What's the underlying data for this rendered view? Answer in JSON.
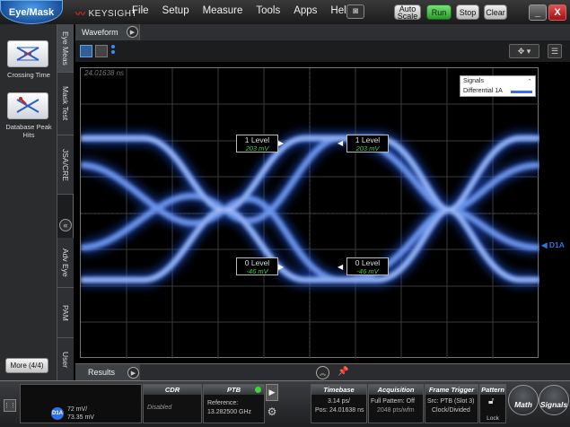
{
  "app": {
    "mode_button": "Eye/Mask",
    "brand": "KEYSIGHT",
    "menu": [
      "File",
      "Setup",
      "Measure",
      "Tools",
      "Apps",
      "Help"
    ],
    "auto_scale": "Auto Scale",
    "run": "Run",
    "stop": "Stop",
    "clear": "Clear",
    "minimize": "_",
    "close": "X"
  },
  "left_panel": {
    "items": [
      {
        "label": "Crossing Time",
        "icon": "crossing-time-icon"
      },
      {
        "label": "Database Peak Hits",
        "icon": "database-peak-icon"
      }
    ],
    "more": "More (4/4)"
  },
  "vertical_tabs": [
    "Eye Meas",
    "Mask Test",
    "JSA/CRE",
    "Adv Eye",
    "PAM",
    "User"
  ],
  "waveform": {
    "tab": "Waveform",
    "timestamp": "24.01638 ns",
    "legend_title": "Signals",
    "legend_signal": "Differential 1A",
    "signal_color": "#3a6ee8",
    "channel_marker": "D1A",
    "levels": [
      {
        "name": "1 Level",
        "value": "203 mV"
      },
      {
        "name": "1 Level",
        "value": "203 mV"
      },
      {
        "name": "0 Level",
        "value": "-46 mV"
      },
      {
        "name": "0 Level",
        "value": "-46 mV"
      }
    ]
  },
  "results": {
    "tab": "Results"
  },
  "status": {
    "channel": {
      "label": "D1A",
      "line1": "72 mV/",
      "line2": "73.35 mV"
    },
    "cdr": {
      "title": "CDR",
      "value": "Disabled"
    },
    "ptb": {
      "title": "PTB",
      "line1": "Reference:",
      "line2": "13.282500 GHz"
    },
    "timebase": {
      "title": "Timebase",
      "line1": "3.14 ps/",
      "line2": "Pos: 24.01638 ns"
    },
    "acquisition": {
      "title": "Acquisition",
      "line1": "Full Pattern: Off",
      "line2": "2048 pts/wfm"
    },
    "frame_trigger": {
      "title": "Frame Trigger",
      "line1": "Src: PTB (Slot 3)",
      "line2": "Clock/Divided"
    },
    "pattern": {
      "title": "Pattern",
      "label": "Lock"
    },
    "math": "Math",
    "signals": "Signals"
  }
}
